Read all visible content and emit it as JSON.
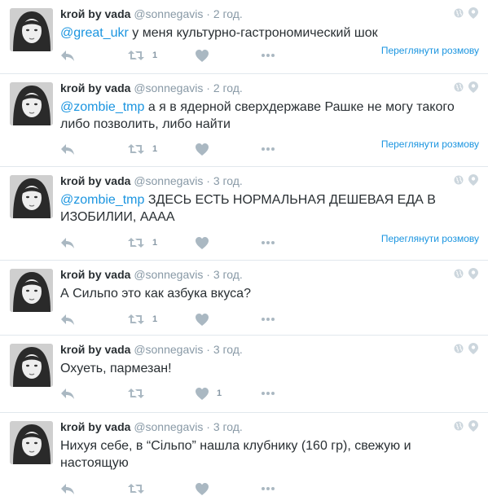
{
  "accent_color": "#1b95e0",
  "muted_color": "#8899a6",
  "tweets": [
    {
      "fullname": "kroй by vada",
      "username": "@sonnegavis",
      "separator": "·",
      "time": "2 год.",
      "mention": "@great_ukr",
      "text": " у меня культурно-гастрономический шок",
      "retweets": "1",
      "likes": "",
      "conversation_link": "Переглянути розмову"
    },
    {
      "fullname": "kroй by vada",
      "username": "@sonnegavis",
      "separator": "·",
      "time": "2 год.",
      "mention": "@zombie_tmp",
      "text": " а я в ядерной сверхдержаве Рашке не могу такого либо позволить, либо найти",
      "retweets": "1",
      "likes": "",
      "conversation_link": "Переглянути розмову"
    },
    {
      "fullname": "kroй by vada",
      "username": "@sonnegavis",
      "separator": "·",
      "time": "3 год.",
      "mention": "@zombie_tmp",
      "text": " ЗДЕСЬ ЕСТЬ НОРМАЛЬНАЯ ДЕШЕВАЯ ЕДА В ИЗОБИЛИИ, АААА",
      "retweets": "1",
      "likes": "",
      "conversation_link": "Переглянути розмову"
    },
    {
      "fullname": "kroй by vada",
      "username": "@sonnegavis",
      "separator": "·",
      "time": "3 год.",
      "mention": "",
      "text": "А Сильпо это как азбука вкуса?",
      "retweets": "1",
      "likes": "",
      "conversation_link": ""
    },
    {
      "fullname": "kroй by vada",
      "username": "@sonnegavis",
      "separator": "·",
      "time": "3 год.",
      "mention": "",
      "text": "Охуеть, пармезан!",
      "retweets": "",
      "likes": "1",
      "conversation_link": ""
    },
    {
      "fullname": "kroй by vada",
      "username": "@sonnegavis",
      "separator": "·",
      "time": "3 год.",
      "mention": "",
      "text": "Нихуя себе, в “Сільпо” нашла клубнику (160 гр), свежую и настоящую",
      "retweets": "",
      "likes": "",
      "conversation_link": ""
    }
  ]
}
